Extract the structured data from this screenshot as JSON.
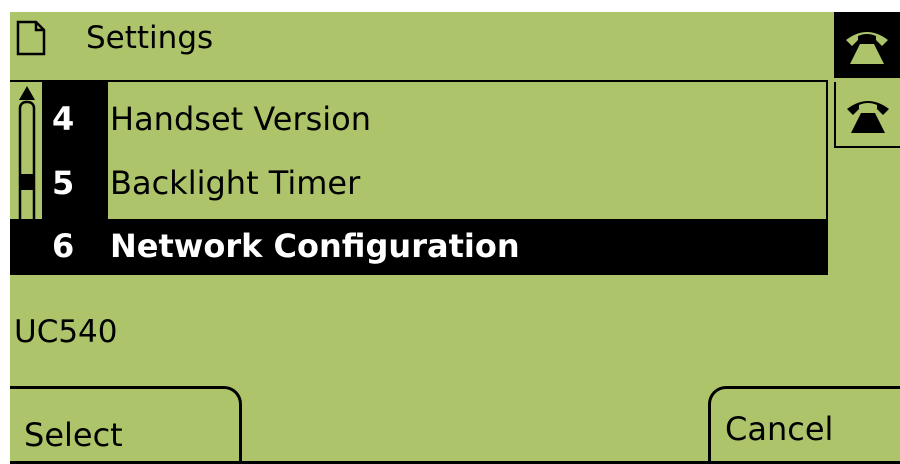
{
  "header": {
    "title": "Settings",
    "icon": "document-icon"
  },
  "line_buttons": [
    {
      "icon": "phone-handset-icon",
      "state": "active"
    },
    {
      "icon": "phone-handset-icon",
      "state": "idle"
    }
  ],
  "menu": {
    "items": [
      {
        "number": "4",
        "label": "Handset Version"
      },
      {
        "number": "5",
        "label": "Backlight Timer"
      },
      {
        "number": "6",
        "label": "Network Configuration",
        "selected": true
      }
    ]
  },
  "status": {
    "text": "UC540"
  },
  "softkeys": {
    "select_label": "Select",
    "cancel_label": "Cancel"
  },
  "colors": {
    "lcd_background": "#adc46a",
    "foreground": "#000000",
    "highlight_text": "#ffffff"
  }
}
